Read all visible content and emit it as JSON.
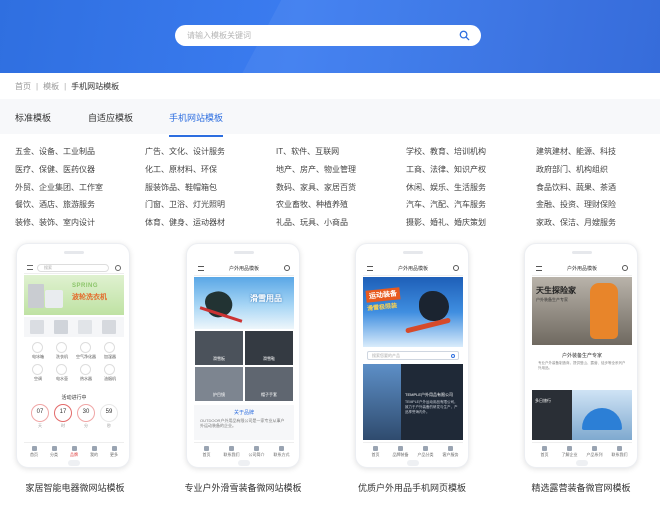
{
  "search": {
    "placeholder": "请输入模板关键词"
  },
  "breadcrumb": {
    "home": "首页",
    "sep1": "|",
    "section": "模板",
    "sep2": "|",
    "current": "手机网站模板"
  },
  "tabs": [
    {
      "label": "标准模板",
      "active": false
    },
    {
      "label": "自适应模板",
      "active": false
    },
    {
      "label": "手机网站模板",
      "active": true
    }
  ],
  "categories": [
    [
      "五金、设备、工业制品",
      "医疗、保健、医药仪器",
      "外贸、企业集团、工作室",
      "餐饮、酒店、旅游服务",
      "装修、装饰、室内设计"
    ],
    [
      "广告、文化、设计服务",
      "化工、原材料、环保",
      "服装饰品、鞋帽箱包",
      "门窗、卫浴、灯光照明",
      "体育、健身、运动器材"
    ],
    [
      "IT、软件、互联网",
      "地产、房产、物业管理",
      "数码、家具、家居百货",
      "农业畜牧、种植养殖",
      "礼品、玩具、小商品"
    ],
    [
      "学校、教育、培训机构",
      "工商、法律、知识产权",
      "休闲、娱乐、生活服务",
      "汽车、汽配、汽车服务",
      "摄影、婚礼、婚庆策划"
    ],
    [
      "建筑建材、能源、科技",
      "政府部门、机构组织",
      "食品饮料、蔬果、茶酒",
      "金融、投资、理财保险",
      "家政、保洁、月嫂服务"
    ]
  ],
  "templates": [
    {
      "caption": "家居智能电器微网站模板",
      "search_text": "搜索",
      "banner_en": "SPRING",
      "banner_title": "波轮洗衣机",
      "products": [
        "电冰箱",
        "洗衣机",
        "空气净化器",
        "加湿器",
        "空调",
        "电水壶",
        "热水器",
        "油烟机"
      ],
      "event_title": "活动进行中",
      "countdown": [
        "07",
        "17",
        "30",
        "59"
      ],
      "countdown_units": [
        "天",
        "时",
        "分",
        "秒"
      ],
      "nav": [
        "首页",
        "分类",
        "品牌",
        "我的",
        "更多"
      ]
    },
    {
      "caption": "专业户外滑雪装备微网站模板",
      "header_title": "户外用品模板",
      "banner_title": "滑雪用品",
      "tiles": [
        "滑雪板",
        "滑雪鞋",
        "护目镜",
        "帽子手套"
      ],
      "about_title": "关于品牌",
      "about_text": "OUTDOOR户外用品有限公司是一家专业从事户外运动装备的企业。",
      "nav": [
        "首页",
        "联系我们",
        "公司简介",
        "联系方式"
      ]
    },
    {
      "caption": "优质户外用品手机网页模板",
      "header_title": "户外用品模板",
      "banner_line1": "运动装备",
      "banner_line2": "滑雪极限装",
      "search_placeholder": "搜索您要的产品",
      "panel_title": "TEMPLE户外用品有限公司",
      "panel_text": "TEMPLE户外运动用品有限公司，致力于户外装备的研发与生产，产品享誉海内外。",
      "nav": [
        "首页",
        "品牌装备",
        "产品分类",
        "客户服务"
      ]
    },
    {
      "caption": "精选露营装备微官网模板",
      "header_title": "户外用品模板",
      "banner_line1": "天生探险家",
      "banner_line2": "户外装备生产专家",
      "intro_title": "户外装备生产专家",
      "intro_text": "专业户外装备制造商，提供登山、露营、徒步等全系列户外用品。",
      "news_title": "多日旅行",
      "nav": [
        "首页",
        "了解企业",
        "产品系列",
        "联系我们"
      ]
    }
  ],
  "colors": {
    "accent": "#2d6ee0",
    "hero": "#3b7cf0"
  }
}
